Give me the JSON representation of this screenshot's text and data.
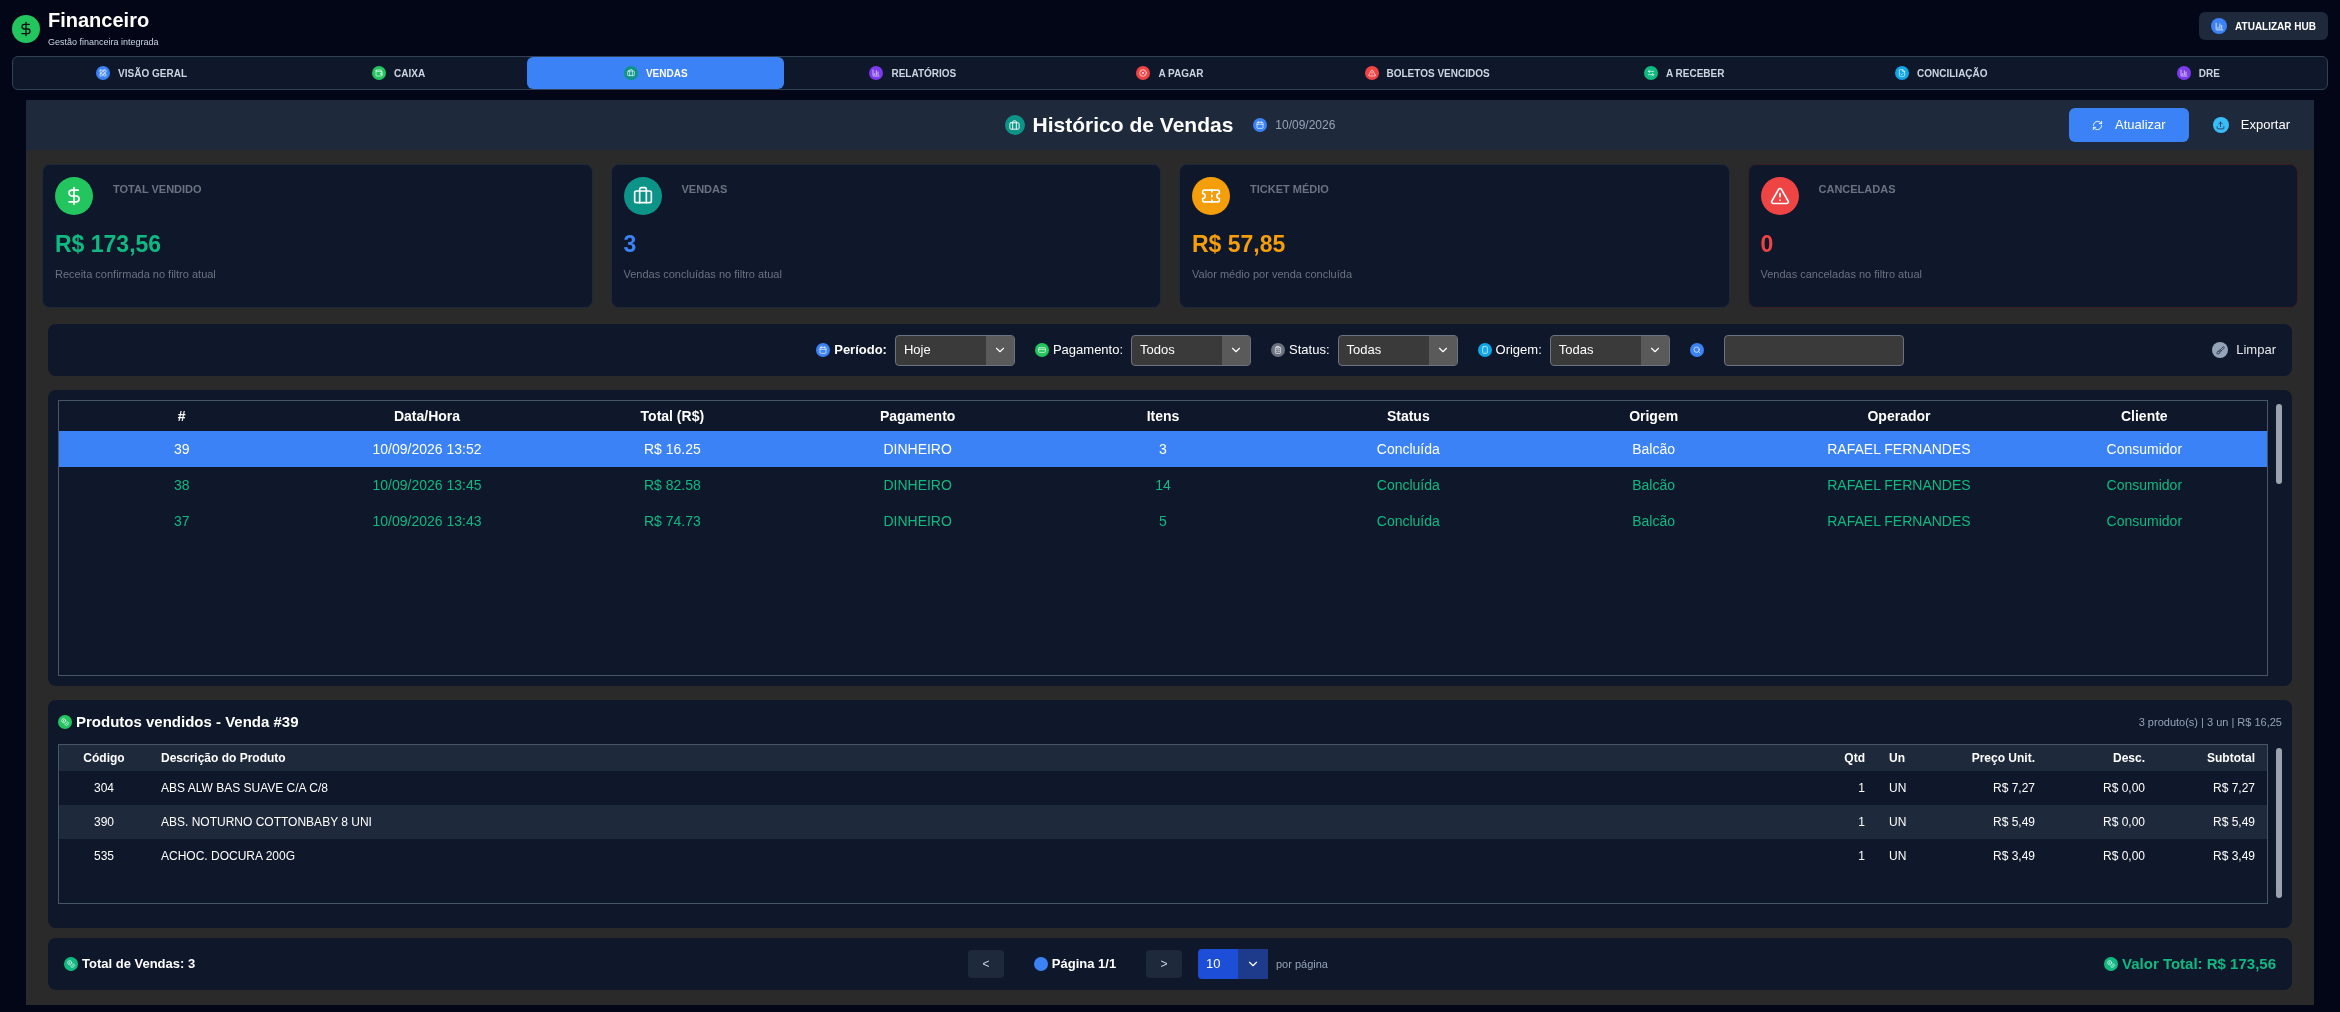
{
  "app": {
    "title": "Financeiro",
    "subtitle": "Gestão financeira integrada",
    "hub_button": "ATUALIZAR HUB"
  },
  "tabs": [
    {
      "label": "VISÃO GERAL",
      "selected": false,
      "kind": "overview"
    },
    {
      "label": "CAIXA",
      "selected": false,
      "kind": "cash"
    },
    {
      "label": "VENDAS",
      "selected": true,
      "kind": "sales"
    },
    {
      "label": "RELATÓRIOS",
      "selected": false,
      "kind": "reports"
    },
    {
      "label": "A PAGAR",
      "selected": false,
      "kind": "payable"
    },
    {
      "label": "BOLETOS VENCIDOS",
      "selected": false,
      "kind": "overdue"
    },
    {
      "label": "A RECEBER",
      "selected": false,
      "kind": "receivable"
    },
    {
      "label": "CONCILIAÇÃO",
      "selected": false,
      "kind": "reconcile"
    },
    {
      "label": "DRE",
      "selected": false,
      "kind": "reports"
    }
  ],
  "page": {
    "title": "Histórico de Vendas",
    "date": "10/09/2026",
    "refresh_button": "Atualizar",
    "export_button": "Exportar"
  },
  "stats": [
    {
      "label": "TOTAL VENDIDO",
      "value": "R$ 173,56",
      "caption": "Receita confirmada no filtro atual",
      "color": "#10b981",
      "kind": "money"
    },
    {
      "label": "VENDAS",
      "value": "3",
      "caption": "Vendas concluídas no filtro atual",
      "color": "#3b82f6",
      "kind": "bag"
    },
    {
      "label": "TICKET MÉDIO",
      "value": "R$ 57,85",
      "caption": "Valor médio por venda concluída",
      "color": "#f59e0b",
      "kind": "ticket"
    },
    {
      "label": "CANCELADAS",
      "value": "0",
      "caption": "Vendas canceladas no filtro atual",
      "color": "#ef4444",
      "kind": "warning"
    }
  ],
  "filters": {
    "items": [
      {
        "label": "Período:",
        "value": "Hoje",
        "kind": "calendar"
      },
      {
        "label": "Pagamento:",
        "value": "Todos",
        "kind": "payment"
      },
      {
        "label": "Status:",
        "value": "Todas",
        "kind": "status"
      },
      {
        "label": "Origem:",
        "value": "Todas",
        "kind": "origin"
      }
    ],
    "clear_button": "Limpar"
  },
  "sales_table": {
    "columns": [
      "#",
      "Data/Hora",
      "Total (R$)",
      "Pagamento",
      "Itens",
      "Status",
      "Origem",
      "Operador",
      "Cliente"
    ],
    "rows": [
      {
        "selected": true,
        "cells": [
          "39",
          "10/09/2026 13:52",
          "R$ 16.25",
          "DINHEIRO",
          "3",
          "Concluída",
          "Balcão",
          "RAFAEL FERNANDES",
          "Consumidor"
        ]
      },
      {
        "selected": false,
        "cells": [
          "38",
          "10/09/2026 13:45",
          "R$ 82.58",
          "DINHEIRO",
          "14",
          "Concluída",
          "Balcão",
          "RAFAEL FERNANDES",
          "Consumidor"
        ]
      },
      {
        "selected": false,
        "cells": [
          "37",
          "10/09/2026 13:43",
          "R$ 74.73",
          "DINHEIRO",
          "5",
          "Concluída",
          "Balcão",
          "RAFAEL FERNANDES",
          "Consumidor"
        ]
      }
    ]
  },
  "products": {
    "title": "Produtos vendidos - Venda #39",
    "summary": "3 produto(s) | 3 un | R$ 16,25",
    "columns": [
      "Código",
      "Descrição do Produto",
      "Qtd",
      "Un",
      "Preço Unit.",
      "Desc.",
      "Subtotal"
    ],
    "rows": [
      [
        "304",
        "ABS ALW BAS SUAVE C/A C/8",
        "1",
        "UN",
        "R$ 7,27",
        "R$ 0,00",
        "R$ 7,27"
      ],
      [
        "390",
        "ABS. NOTURNO COTTONBABY 8 UNI",
        "1",
        "UN",
        "R$ 5,49",
        "R$ 0,00",
        "R$ 5,49"
      ],
      [
        "535",
        "ACHOC. DOCURA 200G",
        "1",
        "UN",
        "R$ 3,49",
        "R$ 0,00",
        "R$ 3,49"
      ]
    ]
  },
  "footer": {
    "total": "Total de Vendas: 3",
    "prev_button": "<",
    "page": "Página 1/1",
    "next_button": ">",
    "per_page": "10",
    "per_page_label": "por página",
    "total_value": "Valor Total: R$ 173,56"
  }
}
